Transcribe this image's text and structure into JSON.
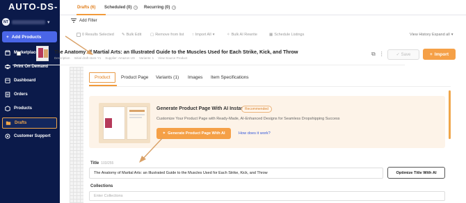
{
  "sidebar": {
    "logo": "AUTO-DS-",
    "store_initials": "NT",
    "add_products_label": "Add Products",
    "items": [
      {
        "label": "Marketplace",
        "icon": "store-icon"
      },
      {
        "label": "Print On Demand",
        "icon": "print-icon"
      },
      {
        "label": "Dashboard",
        "icon": "dashboard-icon"
      },
      {
        "label": "Orders",
        "icon": "cart-icon"
      },
      {
        "label": "Products",
        "icon": "box-icon"
      },
      {
        "label": "Drafts",
        "icon": "folder-icon"
      },
      {
        "label": "Customer Support",
        "icon": "support-icon"
      }
    ],
    "active_item": "Drafts"
  },
  "tabs": [
    {
      "label": "Drafts (6)"
    },
    {
      "label": "Scheduled (0)"
    },
    {
      "label": "Recurring (0)"
    }
  ],
  "filter": {
    "label": "Add Filter"
  },
  "toolbar": {
    "selected": "0 Results Selected",
    "bulk_edit": "Bulk Edit",
    "remove": "Remove from list",
    "import_all": "Import All",
    "bulk_ai": "Bulk AI Rewrite",
    "schedule": "Schedule Listings",
    "view_history": "View History",
    "expand_all": "Expand all"
  },
  "product": {
    "title": "The Anatomy of Martial Arts: an Illustrated Guide to the Muscles Used for Each Strike, Kick, and Throw",
    "meta": [
      "Description",
      "Initial draft store Y1",
      "Supplier: Amazon US",
      "Variants: 1",
      "View Source Product"
    ],
    "save_label": "Save",
    "import_label": "Import"
  },
  "product_tabs": [
    "Product",
    "Product Page",
    "Variants (1)",
    "Images",
    "Item Specifications"
  ],
  "ai_card": {
    "title": "Generate Product Page With AI Instantly",
    "badge": "Recommended",
    "description": "Customize Your Product Page with Ready-Made, AI-Enhanced Designs for Seamless Dropshipping Success",
    "button_label": "Generate Product Page With AI",
    "link_label": "How does it work?"
  },
  "fields": {
    "title_label": "Title",
    "title_count": "103/255",
    "title_value": "The Anatomy of Martial Arts: an Illustrated Guide to the Muscles Used for Each Strike, Kick, and Throw",
    "optimize_label": "Optimize Title With AI",
    "collections_label": "Collections",
    "collections_placeholder": "Enter Collections"
  },
  "colors": {
    "sidebar": "#0b1a4a",
    "accent": "#f5a047",
    "primary_button": "#4a66e8",
    "link": "#3357d9"
  }
}
